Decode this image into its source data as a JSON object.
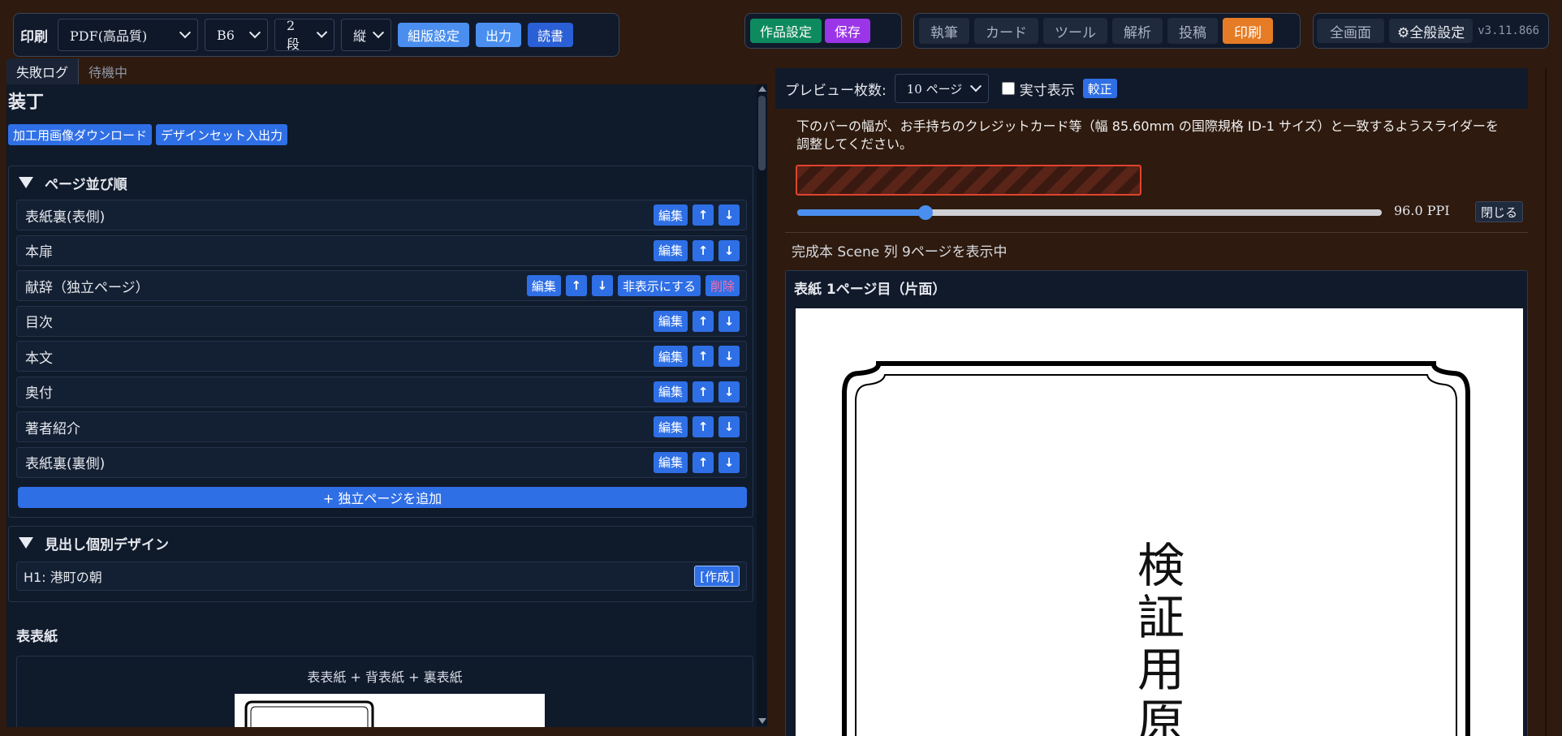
{
  "toolbar_left": {
    "title": "印刷",
    "format": "PDF(高品質)",
    "size": "B6",
    "columns": "2 段",
    "orientation": "縦",
    "btn_layout": "組版設定",
    "btn_output": "出力",
    "btn_read": "読書"
  },
  "toolbar_mid": {
    "work_settings": "作品設定",
    "save": "保存"
  },
  "nav_tabs": [
    "執筆",
    "カード",
    "ツール",
    "解析",
    "投稿",
    "印刷"
  ],
  "toolbar_right": {
    "fullscreen": "全画面",
    "general": "⚙全般設定",
    "version": "v3.11.866"
  },
  "log_tabs": {
    "fail": "失敗ログ",
    "waiting": "待機中"
  },
  "left": {
    "heading": "装丁",
    "btn_download": "加工用画像ダウンロード",
    "btn_designset": "デザインセット入出力",
    "page_order_title": "ページ並び順",
    "edit": "編集",
    "up": "↑",
    "down": "↓",
    "hide": "非表示にする",
    "delete": "削除",
    "pages": [
      "表紙裏(表側)",
      "本扉",
      "献辞（独立ページ）",
      "目次",
      "本文",
      "奥付",
      "著者紹介",
      "表紙裏(裏側)"
    ],
    "add_page": "+ 独立ページを追加",
    "heading_design_title": "見出し個別デザイン",
    "h1_label": "H1: 港町の朝",
    "create": "[作成]",
    "cover_title": "表表紙",
    "cover_sub": "表表紙 + 背表紙 + 裏表紙"
  },
  "right": {
    "preview_label": "プレビュー枚数:",
    "preview_value": "10 ページ",
    "actual_size": "実寸表示",
    "calibrate": "較正",
    "calib_text": "下のバーの幅が、お手持ちのクレジットカード等（幅 85.60mm の国際規格 ID-1 サイズ）と一致するようスライダーを調整してください。",
    "slider_value": 0.22,
    "ppi": "96.0 PPI",
    "close": "閉じる",
    "status": "完成本 Scene 列 9ページを表示中",
    "page_title": "表紙 1ページ目（片面）",
    "vertical_text": [
      "検",
      "証",
      "用",
      "原"
    ]
  },
  "colors": {
    "green": "#0e8a5f",
    "purple": "#9b35e8",
    "orange": "#e57c25",
    "blue": "#2f6fe6"
  }
}
